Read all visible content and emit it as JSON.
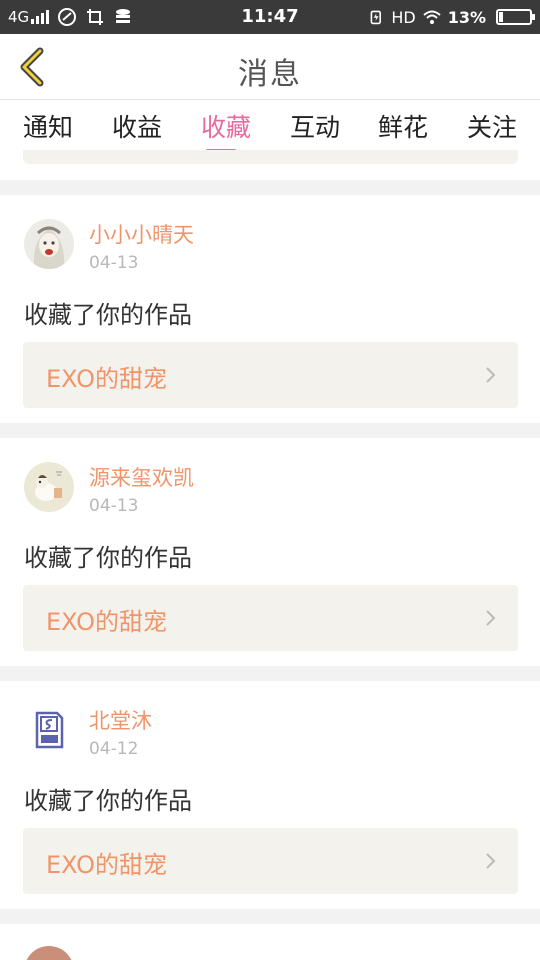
{
  "status_bar": {
    "network": "4G",
    "time": "11:47",
    "hd": "HD",
    "battery": "13%"
  },
  "header": {
    "title": "消息"
  },
  "tabs": [
    {
      "label": "通知",
      "active": false
    },
    {
      "label": "收益",
      "active": false
    },
    {
      "label": "收藏",
      "active": true
    },
    {
      "label": "互动",
      "active": false
    },
    {
      "label": "鲜花",
      "active": false
    },
    {
      "label": "关注",
      "active": false
    }
  ],
  "messages": [
    {
      "username": "小小小晴天",
      "date": "04-13",
      "action": "收藏了你的作品",
      "work": "EXO的甜宠"
    },
    {
      "username": "源来玺欢凯",
      "date": "04-13",
      "action": "收藏了你的作品",
      "work": "EXO的甜宠"
    },
    {
      "username": "北堂沐",
      "date": "04-12",
      "action": "收藏了你的作品",
      "work": "EXO的甜宠"
    }
  ],
  "colors": {
    "accent": "#e86aa0",
    "username": "#f0956a",
    "work_bg": "#f3f2ec"
  }
}
